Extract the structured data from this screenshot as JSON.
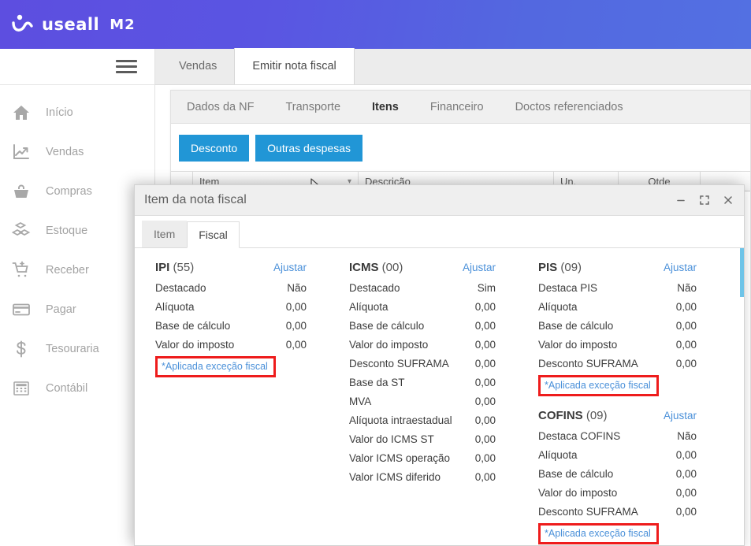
{
  "brand": {
    "name": "useall",
    "suffix": "M2",
    "logo_icon": "useall-wave-logo-icon"
  },
  "sidebar": {
    "menu_icon": "hamburger-menu-icon",
    "items": [
      {
        "label": "Início",
        "icon": "home-icon"
      },
      {
        "label": "Vendas",
        "icon": "chart-line-up-icon"
      },
      {
        "label": "Compras",
        "icon": "shopping-basket-icon"
      },
      {
        "label": "Estoque",
        "icon": "boxes-stack-icon"
      },
      {
        "label": "Receber",
        "icon": "cart-plus-icon"
      },
      {
        "label": "Pagar",
        "icon": "credit-card-icon"
      },
      {
        "label": "Tesouraria",
        "icon": "dollar-sign-icon"
      },
      {
        "label": "Contábil",
        "icon": "calculator-icon"
      }
    ]
  },
  "workspace": {
    "tabs": [
      {
        "label": "Vendas",
        "active": false
      },
      {
        "label": "Emitir nota fiscal",
        "active": true
      }
    ],
    "subtabs": [
      {
        "label": "Dados da NF",
        "active": false
      },
      {
        "label": "Transporte",
        "active": false
      },
      {
        "label": "Itens",
        "active": true
      },
      {
        "label": "Financeiro",
        "active": false
      },
      {
        "label": "Doctos referenciados",
        "active": false
      }
    ],
    "buttons": [
      {
        "label": "Desconto"
      },
      {
        "label": "Outras despesas"
      }
    ],
    "grid_headers": {
      "item": "Item",
      "descricao": "Descrição",
      "un": "Un.",
      "qtde": "Qtde"
    }
  },
  "modal": {
    "title": "Item da nota fiscal",
    "controls": {
      "minimize_icon": "minimize-icon",
      "maximize_icon": "maximize-icon",
      "close_icon": "close-icon"
    },
    "tabs": [
      {
        "label": "Item",
        "active": false
      },
      {
        "label": "Fiscal",
        "active": true
      }
    ],
    "adjust_label": "Ajustar",
    "exception_note": "*Aplicada exceção fiscal",
    "groups": [
      {
        "name": "IPI",
        "code": "(55)",
        "column": "left",
        "rows": [
          {
            "label": "Destacado",
            "value": "Não"
          },
          {
            "label": "Alíquota",
            "value": "0,00"
          },
          {
            "label": "Base de cálculo",
            "value": "0,00"
          },
          {
            "label": "Valor do imposto",
            "value": "0,00"
          }
        ],
        "has_exception": true
      },
      {
        "name": "ICMS",
        "code": "(00)",
        "column": "center",
        "rows": [
          {
            "label": "Destacado",
            "value": "Sim"
          },
          {
            "label": "Alíquota",
            "value": "0,00"
          },
          {
            "label": "Base de cálculo",
            "value": "0,00"
          },
          {
            "label": "Valor do imposto",
            "value": "0,00"
          },
          {
            "label": "Desconto SUFRAMA",
            "value": "0,00"
          },
          {
            "label": "Base da ST",
            "value": "0,00"
          },
          {
            "label": "MVA",
            "value": "0,00"
          },
          {
            "label": "Alíquota intraestadual",
            "value": "0,00"
          },
          {
            "label": "Valor do ICMS ST",
            "value": "0,00"
          },
          {
            "label": "Valor ICMS operação",
            "value": "0,00"
          },
          {
            "label": "Valor ICMS diferido",
            "value": "0,00"
          }
        ],
        "has_exception": false
      },
      {
        "name": "PIS",
        "code": "(09)",
        "column": "right",
        "rows": [
          {
            "label": "Destaca PIS",
            "value": "Não"
          },
          {
            "label": "Alíquota",
            "value": "0,00"
          },
          {
            "label": "Base de cálculo",
            "value": "0,00"
          },
          {
            "label": "Valor do imposto",
            "value": "0,00"
          },
          {
            "label": "Desconto SUFRAMA",
            "value": "0,00"
          }
        ],
        "has_exception": true
      },
      {
        "name": "COFINS",
        "code": "(09)",
        "column": "right",
        "rows": [
          {
            "label": "Destaca COFINS",
            "value": "Não"
          },
          {
            "label": "Alíquota",
            "value": "0,00"
          },
          {
            "label": "Base de cálculo",
            "value": "0,00"
          },
          {
            "label": "Valor do imposto",
            "value": "0,00"
          },
          {
            "label": "Desconto SUFRAMA",
            "value": "0,00"
          }
        ],
        "has_exception": true
      }
    ]
  },
  "colors": {
    "brand_purple": "#5a55e2",
    "button_blue": "#2196d6",
    "link_blue": "#4a90d9",
    "highlight_red": "#ee1c1c",
    "scrollbar_blue": "#6ec4e8"
  }
}
